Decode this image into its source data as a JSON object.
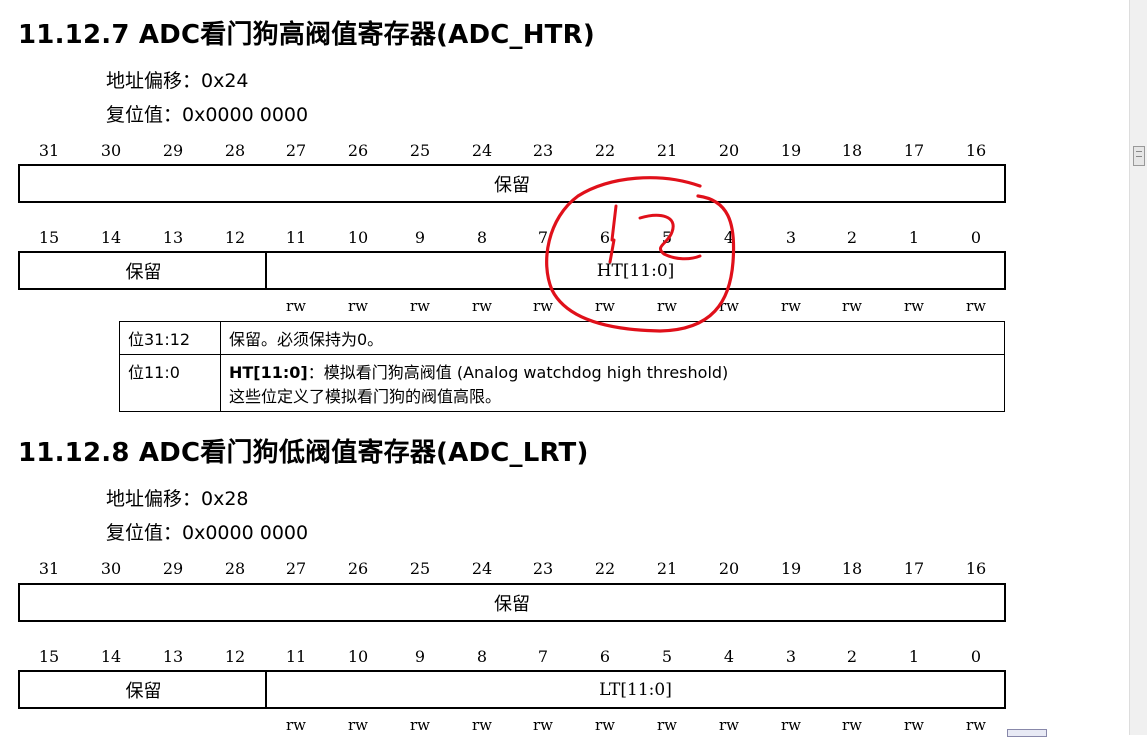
{
  "section1": {
    "heading": "11.12.7  ADC看门狗高阀值寄存器(ADC_HTR)",
    "offset": "地址偏移：0x24",
    "reset": "复位值：0x0000 0000",
    "high_bits": [
      "31",
      "30",
      "29",
      "28",
      "27",
      "26",
      "25",
      "24",
      "23",
      "22",
      "21",
      "20",
      "19",
      "18",
      "17",
      "16"
    ],
    "low_bits": [
      "15",
      "14",
      "13",
      "12",
      "11",
      "10",
      "9",
      "8",
      "7",
      "6",
      "5",
      "4",
      "3",
      "2",
      "1",
      "0"
    ],
    "upper_reserved": "保留",
    "lower_reserved": "保留",
    "field": "HT[11:0]",
    "access": [
      "rw",
      "rw",
      "rw",
      "rw",
      "rw",
      "rw",
      "rw",
      "rw",
      "rw",
      "rw",
      "rw",
      "rw"
    ],
    "table": [
      {
        "bits": "位31:12",
        "desc_line1": "保留。必须保持为0。"
      },
      {
        "bits": "位11:0",
        "desc_name": "HT[11:0]",
        "desc_rest": "：模拟看门狗高阀值 (Analog watchdog high threshold)",
        "desc_line2": "这些位定义了模拟看门狗的阀值高限。"
      }
    ]
  },
  "section2": {
    "heading": "11.12.8  ADC看门狗低阀值寄存器(ADC_LRT)",
    "offset": "地址偏移：0x28",
    "reset": "复位值：0x0000 0000",
    "upper_reserved": "保留",
    "lower_reserved": "保留",
    "field": "LT[11:0]"
  },
  "colors": {
    "annotation": "#e0101a",
    "text": "#000000"
  },
  "icons": {
    "scrollbar_grip": "grip-icon"
  }
}
